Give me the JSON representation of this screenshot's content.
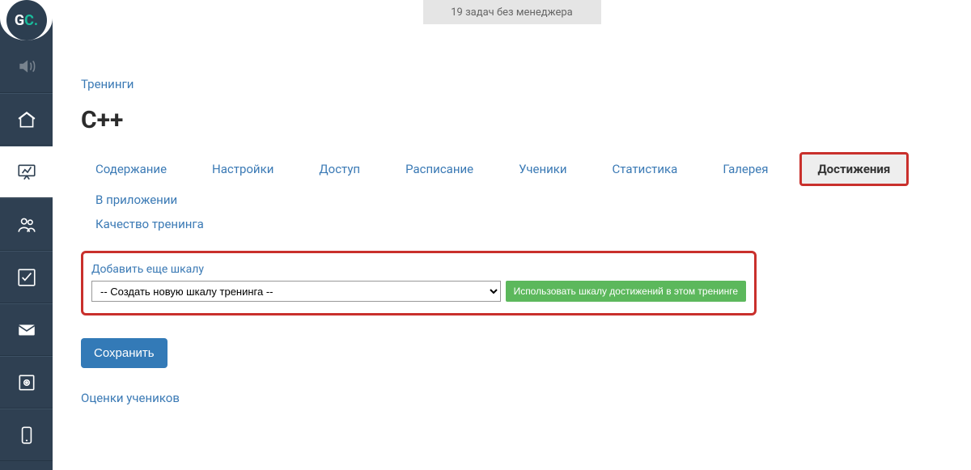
{
  "topbar": {
    "tasks": "19 задач без менеджера"
  },
  "logo": {
    "g": "G",
    "c": "C",
    "dot": "."
  },
  "breadcrumb": "Тренинги",
  "page_title": "С++",
  "tabs": {
    "content": "Содержание",
    "settings": "Настройки",
    "access": "Доступ",
    "schedule": "Расписание",
    "students": "Ученики",
    "stats": "Статистика",
    "gallery": "Галерея",
    "achievements": "Достижения",
    "in_app": "В приложении",
    "quality": "Качество тренинга"
  },
  "panel": {
    "label": "Добавить еще шкалу",
    "select_value": "-- Создать новую шкалу тренинга --",
    "apply": "Использовать шкалу достижений в этом тренинге"
  },
  "save": "Сохранить",
  "grades_link": "Оценки учеников"
}
